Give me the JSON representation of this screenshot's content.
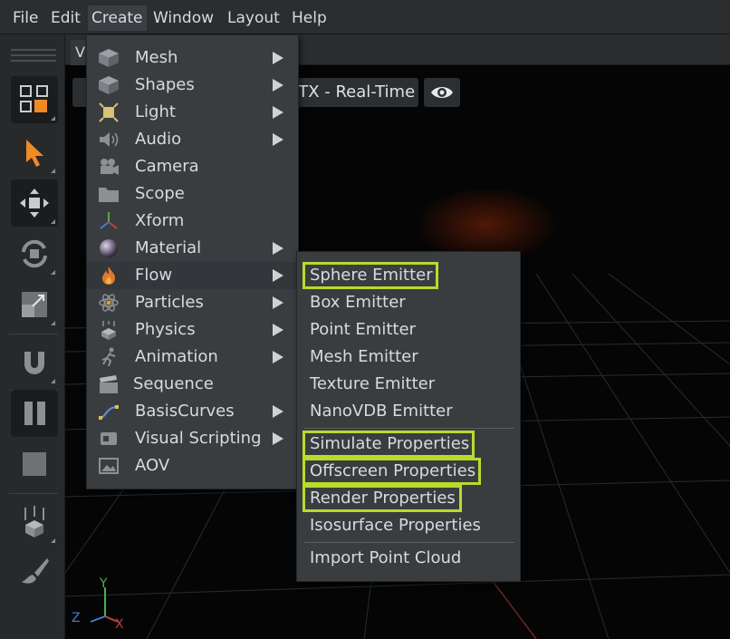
{
  "menubar": {
    "items": [
      "File",
      "Edit",
      "Create",
      "Window",
      "Layout",
      "Help"
    ],
    "active": "Create"
  },
  "viewport": {
    "tab_label": "Viewport",
    "renderer_label": "RTX - Real-Time",
    "axes": {
      "y": "Y",
      "z": "Z",
      "x": "X"
    }
  },
  "toolbar": {
    "tools": [
      "select-mode",
      "select",
      "move",
      "rotate",
      "scale",
      "snap",
      "pause",
      "stop",
      "drop",
      "paint"
    ],
    "selected": [
      "select-mode",
      "move",
      "pause"
    ]
  },
  "create_menu": {
    "items": [
      {
        "label": "Mesh",
        "icon": "cube-icon",
        "submenu": true
      },
      {
        "label": "Shapes",
        "icon": "shapes-icon",
        "submenu": true
      },
      {
        "label": "Light",
        "icon": "light-icon",
        "submenu": true
      },
      {
        "label": "Audio",
        "icon": "speaker-icon",
        "submenu": true
      },
      {
        "label": "Camera",
        "icon": "camera-icon",
        "submenu": false
      },
      {
        "label": "Scope",
        "icon": "folder-icon",
        "submenu": false
      },
      {
        "label": "Xform",
        "icon": "xform-axes-icon",
        "submenu": false
      },
      {
        "label": "Material",
        "icon": "material-sphere-icon",
        "submenu": true
      },
      {
        "label": "Flow",
        "icon": "flame-icon",
        "submenu": true
      },
      {
        "label": "Particles",
        "icon": "atom-icon",
        "submenu": true
      },
      {
        "label": "Physics",
        "icon": "physics-icon",
        "submenu": true
      },
      {
        "label": "Animation",
        "icon": "running-figure-icon",
        "submenu": true
      },
      {
        "label": "Sequence",
        "icon": "clapperboard-icon",
        "submenu": false
      },
      {
        "label": "BasisCurves",
        "icon": "curve-icon",
        "submenu": true
      },
      {
        "label": "Visual Scripting",
        "icon": "graph-node-icon",
        "submenu": true
      },
      {
        "label": "AOV",
        "icon": "image-icon",
        "submenu": false
      }
    ],
    "hovered": "Flow"
  },
  "flow_menu": {
    "emitters": [
      {
        "label": "Sphere Emitter",
        "highlighted": true
      },
      {
        "label": "Box Emitter",
        "highlighted": false
      },
      {
        "label": "Point Emitter",
        "highlighted": false
      },
      {
        "label": "Mesh Emitter",
        "highlighted": false
      },
      {
        "label": "Texture Emitter",
        "highlighted": false
      },
      {
        "label": "NanoVDB Emitter",
        "highlighted": false
      }
    ],
    "properties": [
      {
        "label": "Simulate Properties",
        "highlighted": true
      },
      {
        "label": "Offscreen Properties",
        "highlighted": true
      },
      {
        "label": "Render Properties",
        "highlighted": true
      },
      {
        "label": "Isosurface Properties",
        "highlighted": false
      }
    ],
    "import": {
      "label": "Import Point Cloud"
    },
    "highlight_color": "#b7dc2c"
  }
}
